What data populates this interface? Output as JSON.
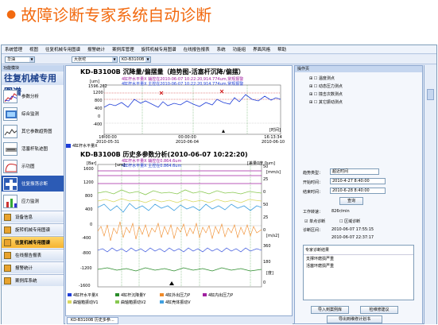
{
  "headline": "故障诊断专家系统自动诊断",
  "menu": [
    "系统管理",
    "视图",
    "往复机械专用图谱",
    "报警统计",
    "案例库管理",
    "旋转机械专用图谱",
    "在线报告报表",
    "系统",
    "功能组",
    "界面风格",
    "帮助"
  ],
  "toolbar": {
    "plant": "华油",
    "unit": "大张坨",
    "machine": "KD-B3100B"
  },
  "sidebar": {
    "header": "功能模块",
    "title": "往复机械专用图谱",
    "items": [
      "参数分析",
      "综合监测",
      "其它参数趋势图",
      "活塞杆轨迹图",
      "示功图",
      "往复振荡诊断",
      "应力监测"
    ],
    "categories": [
      "设备信息",
      "旋转机械专用图谱",
      "往复机械专用图谱",
      "在线报告报表",
      "报警统计",
      "案例库系统"
    ]
  },
  "plot1": {
    "title": "KD-B3100B 沉降量/偏摆量（趋势图-活塞杆沉降/偏摆）",
    "unit": "[um]",
    "ann1": "4缸杆水平量X 辅控在2010-06-07 10:22:20,914.774um,常规报警",
    "ann2": "4缸杆水平量X 主控在2010-06-07 10:22:20,914.774um,常规报警",
    "yticks": [
      "1596.262",
      "1200",
      "800",
      "400",
      "0",
      "-400"
    ],
    "xticks": [
      "16:00:00\n2010-05-31",
      "00:00:00\n2010-06-04",
      "16:13:34\n2010-06-10"
    ],
    "xunit": "[时间]",
    "legend": "4缸杆水平量X"
  },
  "plot2": {
    "title": "KD-B3100B 历史多参数分析(2010-06-07 10:22:20)",
    "unit": "[Bar]",
    "unit2": "[um]",
    "ann1": "4缸杆水平量X 辅控在0.864.6um",
    "ann2": "4缸杆水平量X 主控在0.864.6um",
    "diff": "[差量0度,0um]",
    "yticks": [
      "1600",
      "1200",
      "800",
      "400",
      "0",
      "-400",
      "-800",
      "-1200",
      "-1600"
    ],
    "yticks_um": [
      "1200",
      "800",
      "400",
      "0",
      "-400",
      "-800",
      "-1200"
    ],
    "right_units": [
      "[mm/s]",
      "[m/s2]",
      "[度]"
    ],
    "right_ticks": [
      "50",
      "25",
      "0",
      "50",
      "25",
      "0",
      "360",
      "180",
      "0"
    ],
    "legend": [
      "4缸杆水平量X",
      "4缸杆沉降量Y",
      "4缸外出压力P",
      "4缸内出压力P",
      "曲轴箱振动V1",
      "曲轴箱振动V2",
      "4缸壳体振动V"
    ],
    "colors": {
      "x": "#1e3dd8",
      "y": "#2a8c2a",
      "p1": "#f08a28",
      "p2": "#a020a0",
      "v1": "#d8d860",
      "v2": "#88c850",
      "v": "#40a0e0"
    }
  },
  "right": {
    "header": "操作页",
    "tree": [
      "温度测点",
      "动态压力测点",
      "撞击次数测点",
      "其它振动测点"
    ],
    "type_label": "趋势类型：",
    "type_value": "超近时间",
    "start_label": "开始时间：",
    "start_value": "2010-4-27  8:40:00",
    "end_label": "结束时间：",
    "end_value": "2010-6-28  8:40:00",
    "query": "查询",
    "speed_label": "工作转速：",
    "speed_value": "826r/min",
    "check1": "单点诊断",
    "check2": "区域诊断",
    "diag_label": "诊断区间：",
    "diag_from": "2010-06-07 17:55:15",
    "diag_to": "2010-06-07 22:37:17",
    "result_title": "专家诊断结果",
    "results": [
      "支撑环磨损严重",
      "活塞环磨损严重"
    ],
    "btn_import": "导入到案例库",
    "btn_suggest": "检维修建议",
    "btn_export": "导出到维修计划书"
  },
  "status_tab": "KD-B3100B 历史多参..."
}
